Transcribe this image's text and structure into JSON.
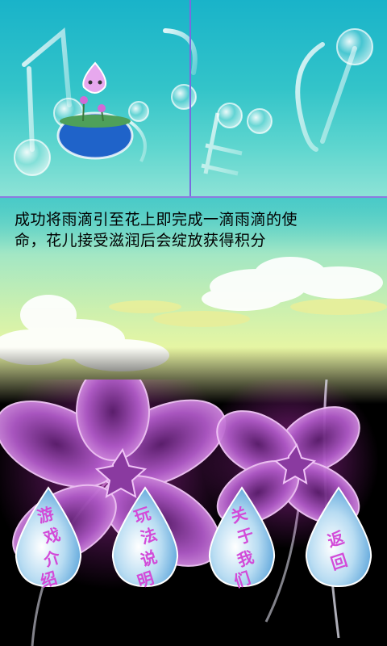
{
  "intro": {
    "line1": "成功将雨滴引至花上即完成一滴雨滴的使",
    "line2": "命，花儿接受滋润后会绽放获得积分"
  },
  "menu": {
    "game_intro": [
      "游",
      "戏",
      "介",
      "绍"
    ],
    "how_to_play": [
      "玩",
      "法",
      "说",
      "明"
    ],
    "about_us": [
      "关",
      "于",
      "我",
      "们"
    ],
    "back": [
      "返",
      "回"
    ]
  },
  "colors": {
    "banner_top": "#19b3c9",
    "label_pink": "#d24ad8",
    "drop_blue": "#6cb7e6",
    "flower_purple": "#b04fc0"
  }
}
